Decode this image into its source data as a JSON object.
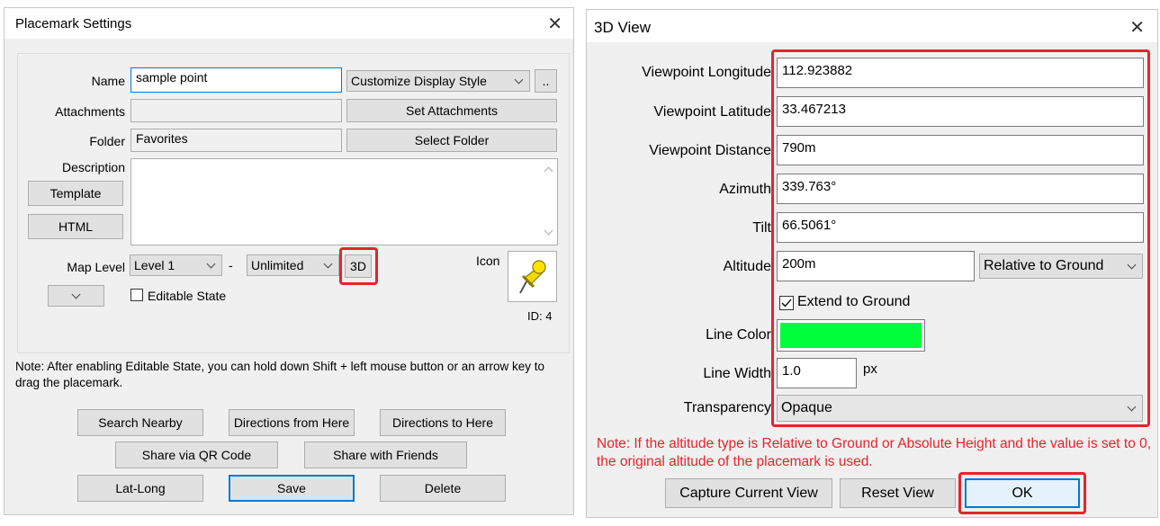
{
  "placemark_dialog": {
    "title": "Placemark Settings",
    "fields": {
      "name_label": "Name",
      "name_value": "sample point",
      "display_style": "Customize Display Style",
      "more_button": "..",
      "attachments_label": "Attachments",
      "attachments_value": "",
      "set_attachments_button": "Set Attachments",
      "folder_label": "Folder",
      "folder_value": "Favorites",
      "select_folder_button": "Select Folder",
      "description_label": "Description",
      "template_button": "Template",
      "html_button": "HTML",
      "description_value": "",
      "map_level_label": "Map Level",
      "map_level_from": "Level 1",
      "map_level_separator": "-",
      "map_level_to": "Unlimited",
      "three_d_button": "3D",
      "icon_label": "Icon",
      "id_label": "ID: 4",
      "editable_state_label": "Editable State",
      "editable_state_checked": false
    },
    "note": "Note: After enabling Editable State, you can hold down Shift + left mouse button or an arrow key to drag the placemark.",
    "buttons": {
      "search_nearby": "Search Nearby",
      "directions_from": "Directions from Here",
      "directions_to": "Directions to Here",
      "share_qr": "Share via QR Code",
      "share_friends": "Share with Friends",
      "lat_long": "Lat-Long",
      "save": "Save",
      "delete": "Delete"
    }
  },
  "view3d_dialog": {
    "title": "3D View",
    "fields": {
      "longitude_label": "Viewpoint Longitude",
      "longitude_value": "112.923882",
      "latitude_label": "Viewpoint Latitude",
      "latitude_value": "33.467213",
      "distance_label": "Viewpoint Distance",
      "distance_value": "790m",
      "azimuth_label": "Azimuth",
      "azimuth_value": "339.763°",
      "tilt_label": "Tilt",
      "tilt_value": "66.5061°",
      "altitude_label": "Altitude",
      "altitude_value": "200m",
      "altitude_mode": "Relative to Ground",
      "extend_to_ground_label": "Extend to Ground",
      "extend_to_ground_checked": true,
      "line_color_label": "Line Color",
      "line_color": "#00ff3a",
      "line_width_label": "Line Width",
      "line_width_value": "1.0",
      "line_width_unit": "px",
      "transparency_label": "Transparency",
      "transparency_value": "Opaque"
    },
    "note": "Note: If the altitude type is Relative to Ground or Absolute Height and the value is set to 0, the original altitude of the placemark is used.",
    "buttons": {
      "capture": "Capture Current View",
      "reset": "Reset View",
      "ok": "OK"
    }
  },
  "colors": {
    "highlight": "#e8232b",
    "note_red": "#e8232b",
    "focus_blue": "#0078d7"
  }
}
